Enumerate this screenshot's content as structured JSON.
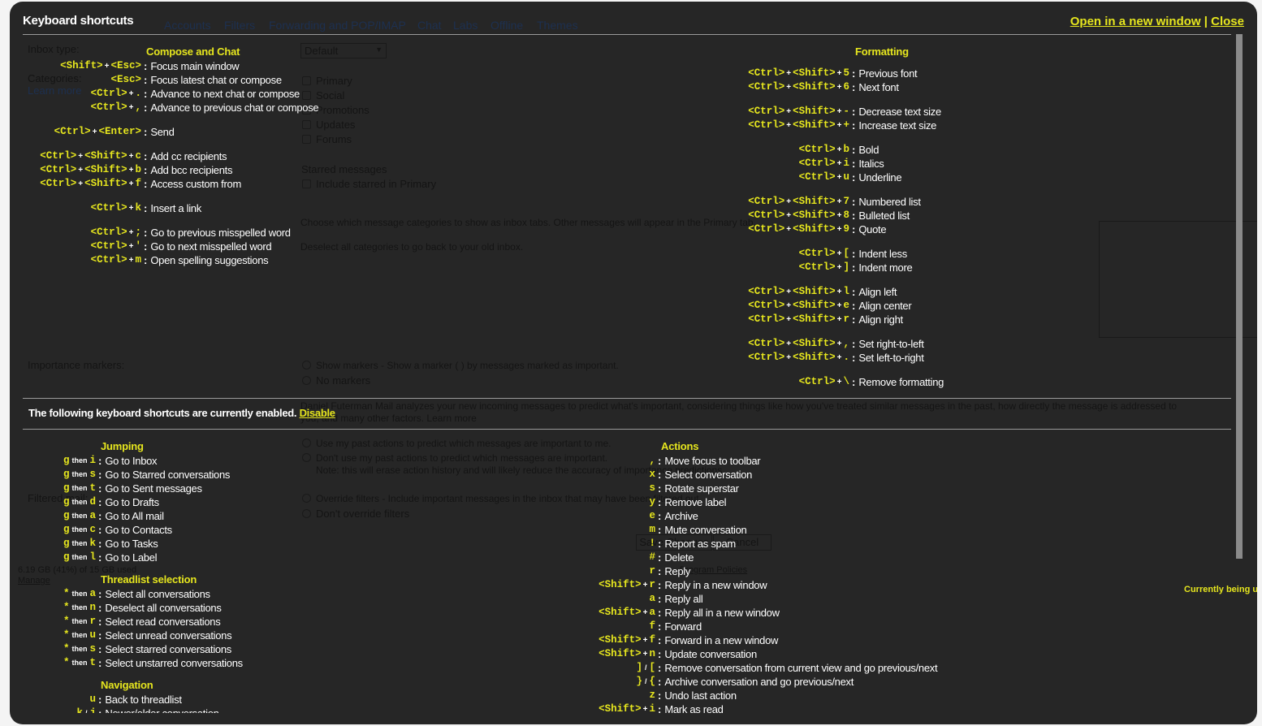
{
  "header": {
    "title": "Keyboard shortcuts",
    "open_new_window": "Open in a new window",
    "separator": "|",
    "close": "Close"
  },
  "enabled_bar": {
    "text": "The following keyboard shortcuts are currently enabled.",
    "disable": "Disable"
  },
  "background": {
    "tabs": [
      "Accounts",
      "Filters",
      "Forwarding and POP/IMAP",
      "Chat",
      "Labs",
      "Offline",
      "Themes"
    ],
    "inbox_type_label": "Inbox type:",
    "inbox_type_value": "Default",
    "categories_label": "Categories:",
    "learn_more": "Learn more",
    "categories": [
      "Primary",
      "Social",
      "Promotions",
      "Updates",
      "Forums"
    ],
    "starred_heading": "Starred messages",
    "starred_option": "Include starred in Primary",
    "categories_help_1": "Choose which message categories to show as inbox tabs. Other messages will appear in the Primary tab.",
    "categories_help_2": "Deselect all categories to go back to your old inbox.",
    "importance_label": "Importance markers:",
    "show_markers": "Show markers - Show a marker (  ) by messages marked as important.",
    "no_markers": "No markers",
    "analyzes_text": "Daniel Futerman Mail analyzes your new incoming messages to predict what's important, considering things like how you've treated similar messages in the past, how directly the message is addressed to you, and many other factors. Learn more",
    "use_past": "Use my past actions to predict which messages are important to me.",
    "dont_use_past": "Don't use my past actions to predict which messages are important.",
    "note": "Note: this will erase action history and will likely reduce the accuracy of importance predictions.",
    "filtered_label": "Filtered mail:",
    "override": "Override filters - Include important messages in the inbox that may have been filtered out.",
    "dont_override": "Don't override filters",
    "storage": "6.19 GB (41%) of 15 GB used",
    "manage": "Manage",
    "save_changes": "Save Changes",
    "cancel": "Cancel",
    "program_policies": "Program Policies",
    "currently_being": "Currently being us"
  },
  "sections": [
    {
      "id": "compose-and-chat",
      "title": "Compose and Chat",
      "rows": [
        {
          "key": [
            "<Shift>",
            "+",
            "<Esc>"
          ],
          "desc": "Focus main window"
        },
        {
          "key": [
            "<Esc>"
          ],
          "desc": "Focus latest chat or compose"
        },
        {
          "key": [
            "<Ctrl>",
            "+",
            "."
          ],
          "desc": "Advance to next chat or compose"
        },
        {
          "key": [
            "<Ctrl>",
            "+",
            ","
          ],
          "desc": "Advance to previous chat or compose"
        },
        null,
        {
          "key": [
            "<Ctrl>",
            "+",
            "<Enter>"
          ],
          "desc": "Send"
        },
        null,
        {
          "key": [
            "<Ctrl>",
            "+",
            "<Shift>",
            "+",
            "c"
          ],
          "desc": "Add cc recipients"
        },
        {
          "key": [
            "<Ctrl>",
            "+",
            "<Shift>",
            "+",
            "b"
          ],
          "desc": "Add bcc recipients"
        },
        {
          "key": [
            "<Ctrl>",
            "+",
            "<Shift>",
            "+",
            "f"
          ],
          "desc": "Access custom from"
        },
        null,
        {
          "key": [
            "<Ctrl>",
            "+",
            "k"
          ],
          "desc": "Insert a link"
        },
        null,
        {
          "key": [
            "<Ctrl>",
            "+",
            ";"
          ],
          "desc": "Go to previous misspelled word"
        },
        {
          "key": [
            "<Ctrl>",
            "+",
            "'"
          ],
          "desc": "Go to next misspelled word"
        },
        {
          "key": [
            "<Ctrl>",
            "+",
            "m"
          ],
          "desc": "Open spelling suggestions"
        }
      ]
    },
    {
      "id": "formatting",
      "title": "Formatting",
      "rows": [
        null,
        {
          "key": [
            "<Ctrl>",
            "+",
            "<Shift>",
            "+",
            "5"
          ],
          "desc": "Previous font"
        },
        {
          "key": [
            "<Ctrl>",
            "+",
            "<Shift>",
            "+",
            "6"
          ],
          "desc": "Next font"
        },
        null,
        {
          "key": [
            "<Ctrl>",
            "+",
            "<Shift>",
            "+",
            "-"
          ],
          "desc": "Decrease text size"
        },
        {
          "key": [
            "<Ctrl>",
            "+",
            "<Shift>",
            "+",
            "+"
          ],
          "desc": "Increase text size"
        },
        null,
        {
          "key": [
            "<Ctrl>",
            "+",
            "b"
          ],
          "desc": "Bold"
        },
        {
          "key": [
            "<Ctrl>",
            "+",
            "i"
          ],
          "desc": "Italics"
        },
        {
          "key": [
            "<Ctrl>",
            "+",
            "u"
          ],
          "desc": "Underline"
        },
        null,
        {
          "key": [
            "<Ctrl>",
            "+",
            "<Shift>",
            "+",
            "7"
          ],
          "desc": "Numbered list"
        },
        {
          "key": [
            "<Ctrl>",
            "+",
            "<Shift>",
            "+",
            "8"
          ],
          "desc": "Bulleted list"
        },
        {
          "key": [
            "<Ctrl>",
            "+",
            "<Shift>",
            "+",
            "9"
          ],
          "desc": "Quote"
        },
        null,
        {
          "key": [
            "<Ctrl>",
            "+",
            "["
          ],
          "desc": "Indent less"
        },
        {
          "key": [
            "<Ctrl>",
            "+",
            "]"
          ],
          "desc": "Indent more"
        },
        null,
        {
          "key": [
            "<Ctrl>",
            "+",
            "<Shift>",
            "+",
            "l"
          ],
          "desc": "Align left"
        },
        {
          "key": [
            "<Ctrl>",
            "+",
            "<Shift>",
            "+",
            "e"
          ],
          "desc": "Align center"
        },
        {
          "key": [
            "<Ctrl>",
            "+",
            "<Shift>",
            "+",
            "r"
          ],
          "desc": "Align right"
        },
        null,
        {
          "key": [
            "<Ctrl>",
            "+",
            "<Shift>",
            "+",
            ","
          ],
          "desc": "Set right-to-left"
        },
        {
          "key": [
            "<Ctrl>",
            "+",
            "<Shift>",
            "+",
            "."
          ],
          "desc": "Set left-to-right"
        },
        null,
        {
          "key": [
            "<Ctrl>",
            "+",
            "\\"
          ],
          "desc": "Remove formatting"
        }
      ]
    },
    {
      "id": "jumping",
      "title": "Jumping",
      "rows": [
        {
          "key": [
            "g",
            "then",
            "i"
          ],
          "desc": "Go to Inbox"
        },
        {
          "key": [
            "g",
            "then",
            "s"
          ],
          "desc": "Go to Starred conversations"
        },
        {
          "key": [
            "g",
            "then",
            "t"
          ],
          "desc": "Go to Sent messages"
        },
        {
          "key": [
            "g",
            "then",
            "d"
          ],
          "desc": "Go to Drafts"
        },
        {
          "key": [
            "g",
            "then",
            "a"
          ],
          "desc": "Go to All mail"
        },
        {
          "key": [
            "g",
            "then",
            "c"
          ],
          "desc": "Go to Contacts"
        },
        {
          "key": [
            "g",
            "then",
            "k"
          ],
          "desc": "Go to Tasks"
        },
        {
          "key": [
            "g",
            "then",
            "l"
          ],
          "desc": "Go to Label"
        }
      ]
    },
    {
      "id": "threadlist-selection",
      "title": "Threadlist selection",
      "rows": [
        {
          "key": [
            "*",
            "then",
            "a"
          ],
          "desc": "Select all conversations"
        },
        {
          "key": [
            "*",
            "then",
            "n"
          ],
          "desc": "Deselect all conversations"
        },
        {
          "key": [
            "*",
            "then",
            "r"
          ],
          "desc": "Select read conversations"
        },
        {
          "key": [
            "*",
            "then",
            "u"
          ],
          "desc": "Select unread conversations"
        },
        {
          "key": [
            "*",
            "then",
            "s"
          ],
          "desc": "Select starred conversations"
        },
        {
          "key": [
            "*",
            "then",
            "t"
          ],
          "desc": "Select unstarred conversations"
        }
      ]
    },
    {
      "id": "navigation",
      "title": "Navigation",
      "rows": [
        {
          "key": [
            "u"
          ],
          "desc": "Back to threadlist"
        },
        {
          "key": [
            "k",
            "/",
            "j"
          ],
          "desc": "Newer/older conversation"
        }
      ]
    },
    {
      "id": "actions",
      "title": "Actions",
      "rows": [
        {
          "key": [
            ","
          ],
          "desc": "Move focus to toolbar"
        },
        {
          "key": [
            "x"
          ],
          "desc": "Select conversation"
        },
        {
          "key": [
            "s"
          ],
          "desc": "Rotate superstar"
        },
        {
          "key": [
            "y"
          ],
          "desc": "Remove label"
        },
        {
          "key": [
            "e"
          ],
          "desc": "Archive"
        },
        {
          "key": [
            "m"
          ],
          "desc": "Mute conversation"
        },
        {
          "key": [
            "!"
          ],
          "desc": "Report as spam"
        },
        {
          "key": [
            "#"
          ],
          "desc": "Delete"
        },
        {
          "key": [
            "r"
          ],
          "desc": "Reply"
        },
        {
          "key": [
            "<Shift>",
            "+",
            "r"
          ],
          "desc": "Reply in a new window"
        },
        {
          "key": [
            "a"
          ],
          "desc": "Reply all"
        },
        {
          "key": [
            "<Shift>",
            "+",
            "a"
          ],
          "desc": "Reply all in a new window"
        },
        {
          "key": [
            "f"
          ],
          "desc": "Forward"
        },
        {
          "key": [
            "<Shift>",
            "+",
            "f"
          ],
          "desc": "Forward in a new window"
        },
        {
          "key": [
            "<Shift>",
            "+",
            "n"
          ],
          "desc": "Update conversation"
        },
        {
          "key": [
            "]",
            "/",
            "["
          ],
          "desc": "Remove conversation from current view and go previous/next"
        },
        {
          "key": [
            "}",
            "/",
            "{"
          ],
          "desc": "Archive conversation and go previous/next"
        },
        {
          "key": [
            "z"
          ],
          "desc": "Undo last action"
        },
        {
          "key": [
            "<Shift>",
            "+",
            "i"
          ],
          "desc": "Mark as read"
        }
      ]
    }
  ],
  "colors": {
    "panel": "#262626",
    "accent": "#e6e61e",
    "text": "#ffffff"
  }
}
